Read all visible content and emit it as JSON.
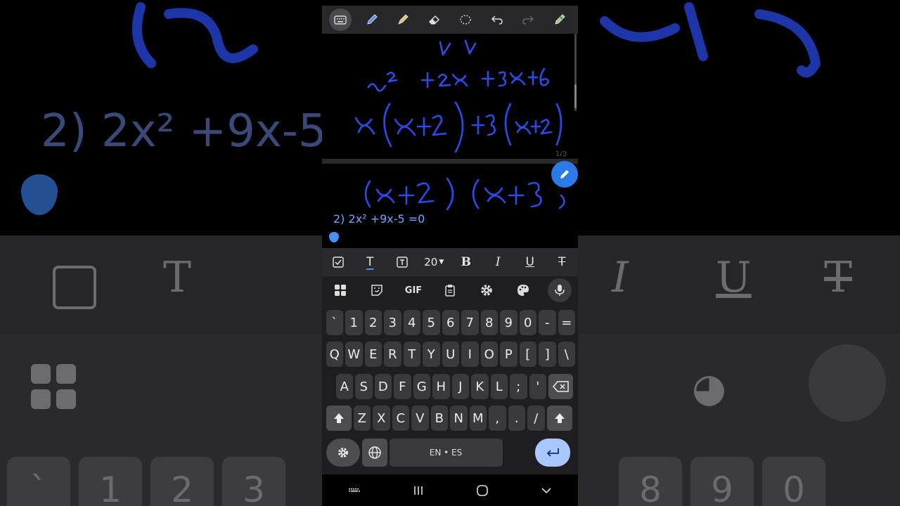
{
  "toolbar": {
    "tools": [
      "keyboard-icon",
      "pen-icon",
      "highlighter-icon",
      "eraser-icon",
      "lasso-icon",
      "undo-icon",
      "redo-icon",
      "pen-settings-icon"
    ],
    "active_tool": "keyboard-icon"
  },
  "canvas": {
    "page_indicator": "1/3",
    "typed_text": "2) 2x² +9x-5 =0",
    "ink_color": "#2d4be6"
  },
  "background": {
    "equation": "2) 2x² +9x-5 ="
  },
  "format_bar": {
    "font_size": "20",
    "bold": "B",
    "italic": "I",
    "underline": "U",
    "strikethrough": "T",
    "text_t": "T"
  },
  "keyboard": {
    "tools": {
      "gif": "GIF"
    },
    "row_numbers": [
      "`",
      "1",
      "2",
      "3",
      "4",
      "5",
      "6",
      "7",
      "8",
      "9",
      "0",
      "-",
      "="
    ],
    "row_top": [
      "Q",
      "W",
      "E",
      "R",
      "T",
      "Y",
      "U",
      "I",
      "O",
      "P",
      "[",
      "]",
      "\\"
    ],
    "row_home": [
      "A",
      "S",
      "D",
      "F",
      "G",
      "H",
      "J",
      "K",
      "L",
      ";",
      "'"
    ],
    "row_bottom": [
      "Z",
      "X",
      "C",
      "V",
      "B",
      "N",
      "M",
      ",",
      ".",
      "/"
    ],
    "space_label": "EN • ES",
    "enter_color": "#a8c8ff"
  },
  "colors": {
    "accent": "#2c7ae8",
    "ink": "#2d4be6",
    "typed_text": "#6ea6ff"
  }
}
